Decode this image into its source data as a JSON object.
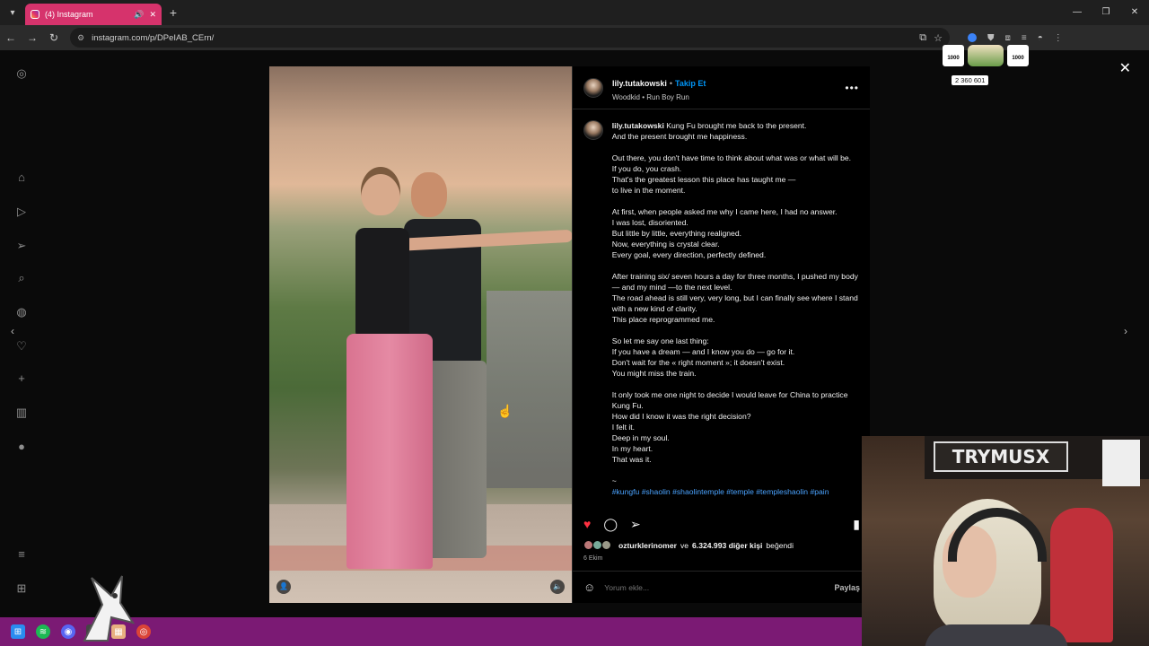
{
  "browser": {
    "tab_title": "(4) Instagram",
    "url": "instagram.com/p/DPeIAB_CErn/"
  },
  "post": {
    "username": "lily.tutakowski",
    "follow_label": "Takip Et",
    "song": "Woodkid • Run Boy Run",
    "caption_paragraphs": [
      "Kung Fu brought me back to the present.\nAnd the present brought me happiness.",
      "Out there, you don't have time to think about what was or what will be.\nIf you do, you crash.\nThat's the greatest lesson this place has taught me —\nto live in the moment.",
      "At first, when people asked me why I came here, I had no answer.\nI was lost, disoriented.\nBut little by little, everything realigned.\nNow, everything is crystal clear.\nEvery goal, every direction, perfectly defined.",
      "After training six/ seven hours a day for three months, I pushed my body — and my mind —to the next level.\nThe road ahead is still very, very long, but I can finally see where I stand with a new kind of clarity.\nThis place reprogrammed me.",
      "So let me say one last thing:\nIf you have a dream — and I know you do — go for it.\nDon't wait for the « right moment »; it doesn't exist.\nYou might miss the train.",
      "It only took me one night to decide I would leave for China to practice Kung Fu.\nHow did I know it was the right decision?\nI felt it.\nDeep in my soul.\nIn my heart.\nThat was it."
    ],
    "caption_tilde": "~",
    "hashtags": "#kungfu #shaolin #shaolintemple #temple #templeshaolin #pain",
    "liked_by_user": "ozturklerinomer",
    "likes_connector": "ve",
    "likes_count": "6.324.993 diğer kişi",
    "likes_suffix": "beğendi",
    "date": "6 Ekim",
    "comment_placeholder": "Yorum ekle...",
    "post_button": "Paylaş"
  },
  "overlay": {
    "badge_left": "1000",
    "badge_right": "1000",
    "counter": "2 360 601",
    "webcam_sign": "TRYMUSX"
  },
  "colors": {
    "tab_accent": "#d6336c",
    "follow_blue": "#0095f6",
    "like_red": "#ff3040",
    "taskbar": "#7b1a74"
  }
}
